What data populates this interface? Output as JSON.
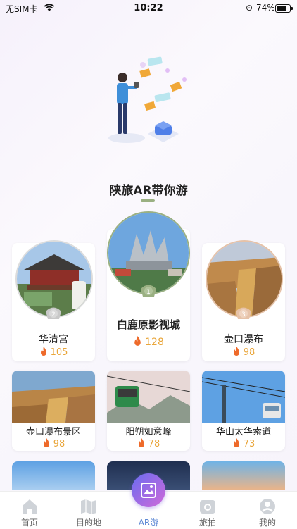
{
  "status_bar": {
    "carrier": "无SIM卡",
    "time": "10:22",
    "battery": "74%"
  },
  "section": {
    "title": "陕旅AR带你游"
  },
  "top_ranked": [
    {
      "rank": "1",
      "name": "白鹿原影视城",
      "hot": "128"
    },
    {
      "rank": "2",
      "name": "华清宫",
      "hot": "105"
    },
    {
      "rank": "3",
      "name": "壶口瀑布",
      "hot": "98"
    }
  ],
  "grid_items": [
    {
      "name": "壶口瀑布景区",
      "hot": "98"
    },
    {
      "name": "阳朔如意峰",
      "hot": "78"
    },
    {
      "name": "华山太华索道",
      "hot": "73"
    }
  ],
  "tabbar": {
    "items": [
      {
        "label": "首页",
        "icon": "home-icon"
      },
      {
        "label": "目的地",
        "icon": "map-icon"
      },
      {
        "label": "AR游",
        "icon": "ar-icon"
      },
      {
        "label": "旅拍",
        "icon": "camera-icon"
      },
      {
        "label": "我的",
        "icon": "profile-icon"
      }
    ],
    "active": "AR游"
  },
  "colors": {
    "accent": "#5a86d4",
    "hot": "#e9a63b",
    "rank1": "#9ab082",
    "rank2": "#c8c8c8",
    "rank3": "#e6c2a8"
  }
}
